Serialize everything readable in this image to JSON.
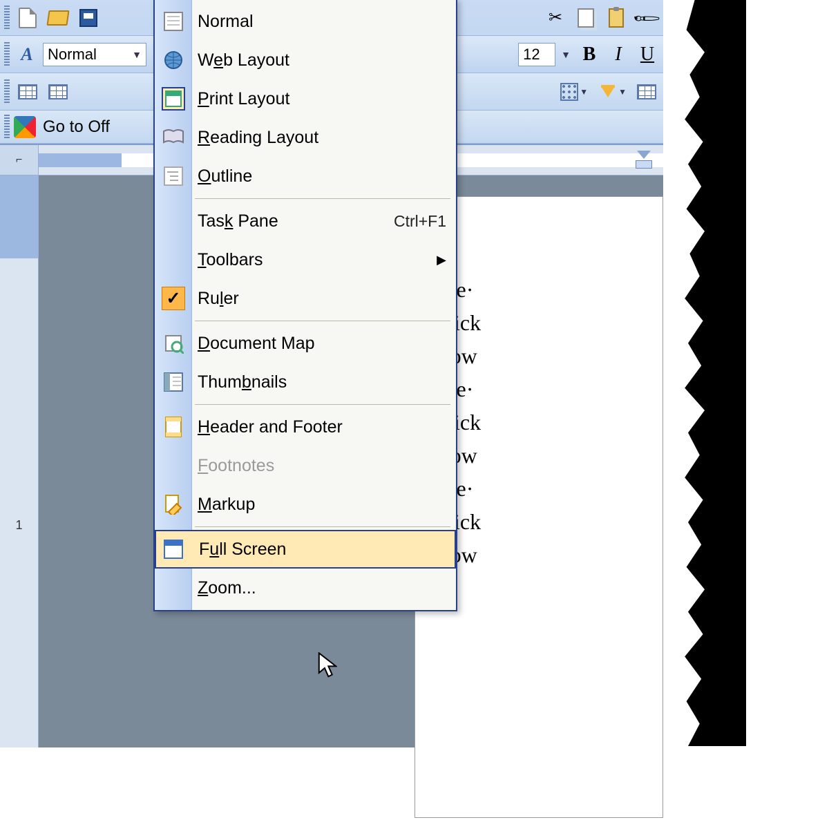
{
  "toolbar": {
    "style_value": "Normal",
    "font_size": "12",
    "bold": "B",
    "italic": "I",
    "underline": "U",
    "go_to_office": "Go to Off"
  },
  "menu": {
    "normal": "Normal",
    "web_layout_pre": "W",
    "web_layout_u": "e",
    "web_layout_post": "b Layout",
    "print_layout_u": "P",
    "print_layout_post": "rint Layout",
    "reading_layout_u": "R",
    "reading_layout_post": "eading Layout",
    "outline_u": "O",
    "outline_post": "utline",
    "task_pane": "Tas",
    "task_pane_u": "k",
    "task_pane_post": " Pane",
    "task_pane_shortcut": "Ctrl+F1",
    "toolbars_u": "T",
    "toolbars_post": "oolbars",
    "ruler": "Ru",
    "ruler_u": "l",
    "ruler_post": "er",
    "doc_map_u": "D",
    "doc_map_post": "ocument Map",
    "thumbnails": "Thum",
    "thumbnails_u": "b",
    "thumbnails_post": "nails",
    "header_footer_u": "H",
    "header_footer_post": "eader and Footer",
    "footnotes_u": "F",
    "footnotes_post": "ootnotes",
    "markup_u": "M",
    "markup_post": "arkup",
    "full_screen": "F",
    "full_screen_u": "u",
    "full_screen_post": "ll Screen",
    "zoom_u": "Z",
    "zoom_post": "oom..."
  },
  "ruler": {
    "tab_corner": "⌐",
    "v1": "1"
  },
  "document": {
    "l1": "The",
    "l2": "quick",
    "l3": "brow",
    "l4": "The",
    "l5": "quick",
    "l6": "brow",
    "l7": "The",
    "l8": "quick",
    "l9": "brow"
  }
}
